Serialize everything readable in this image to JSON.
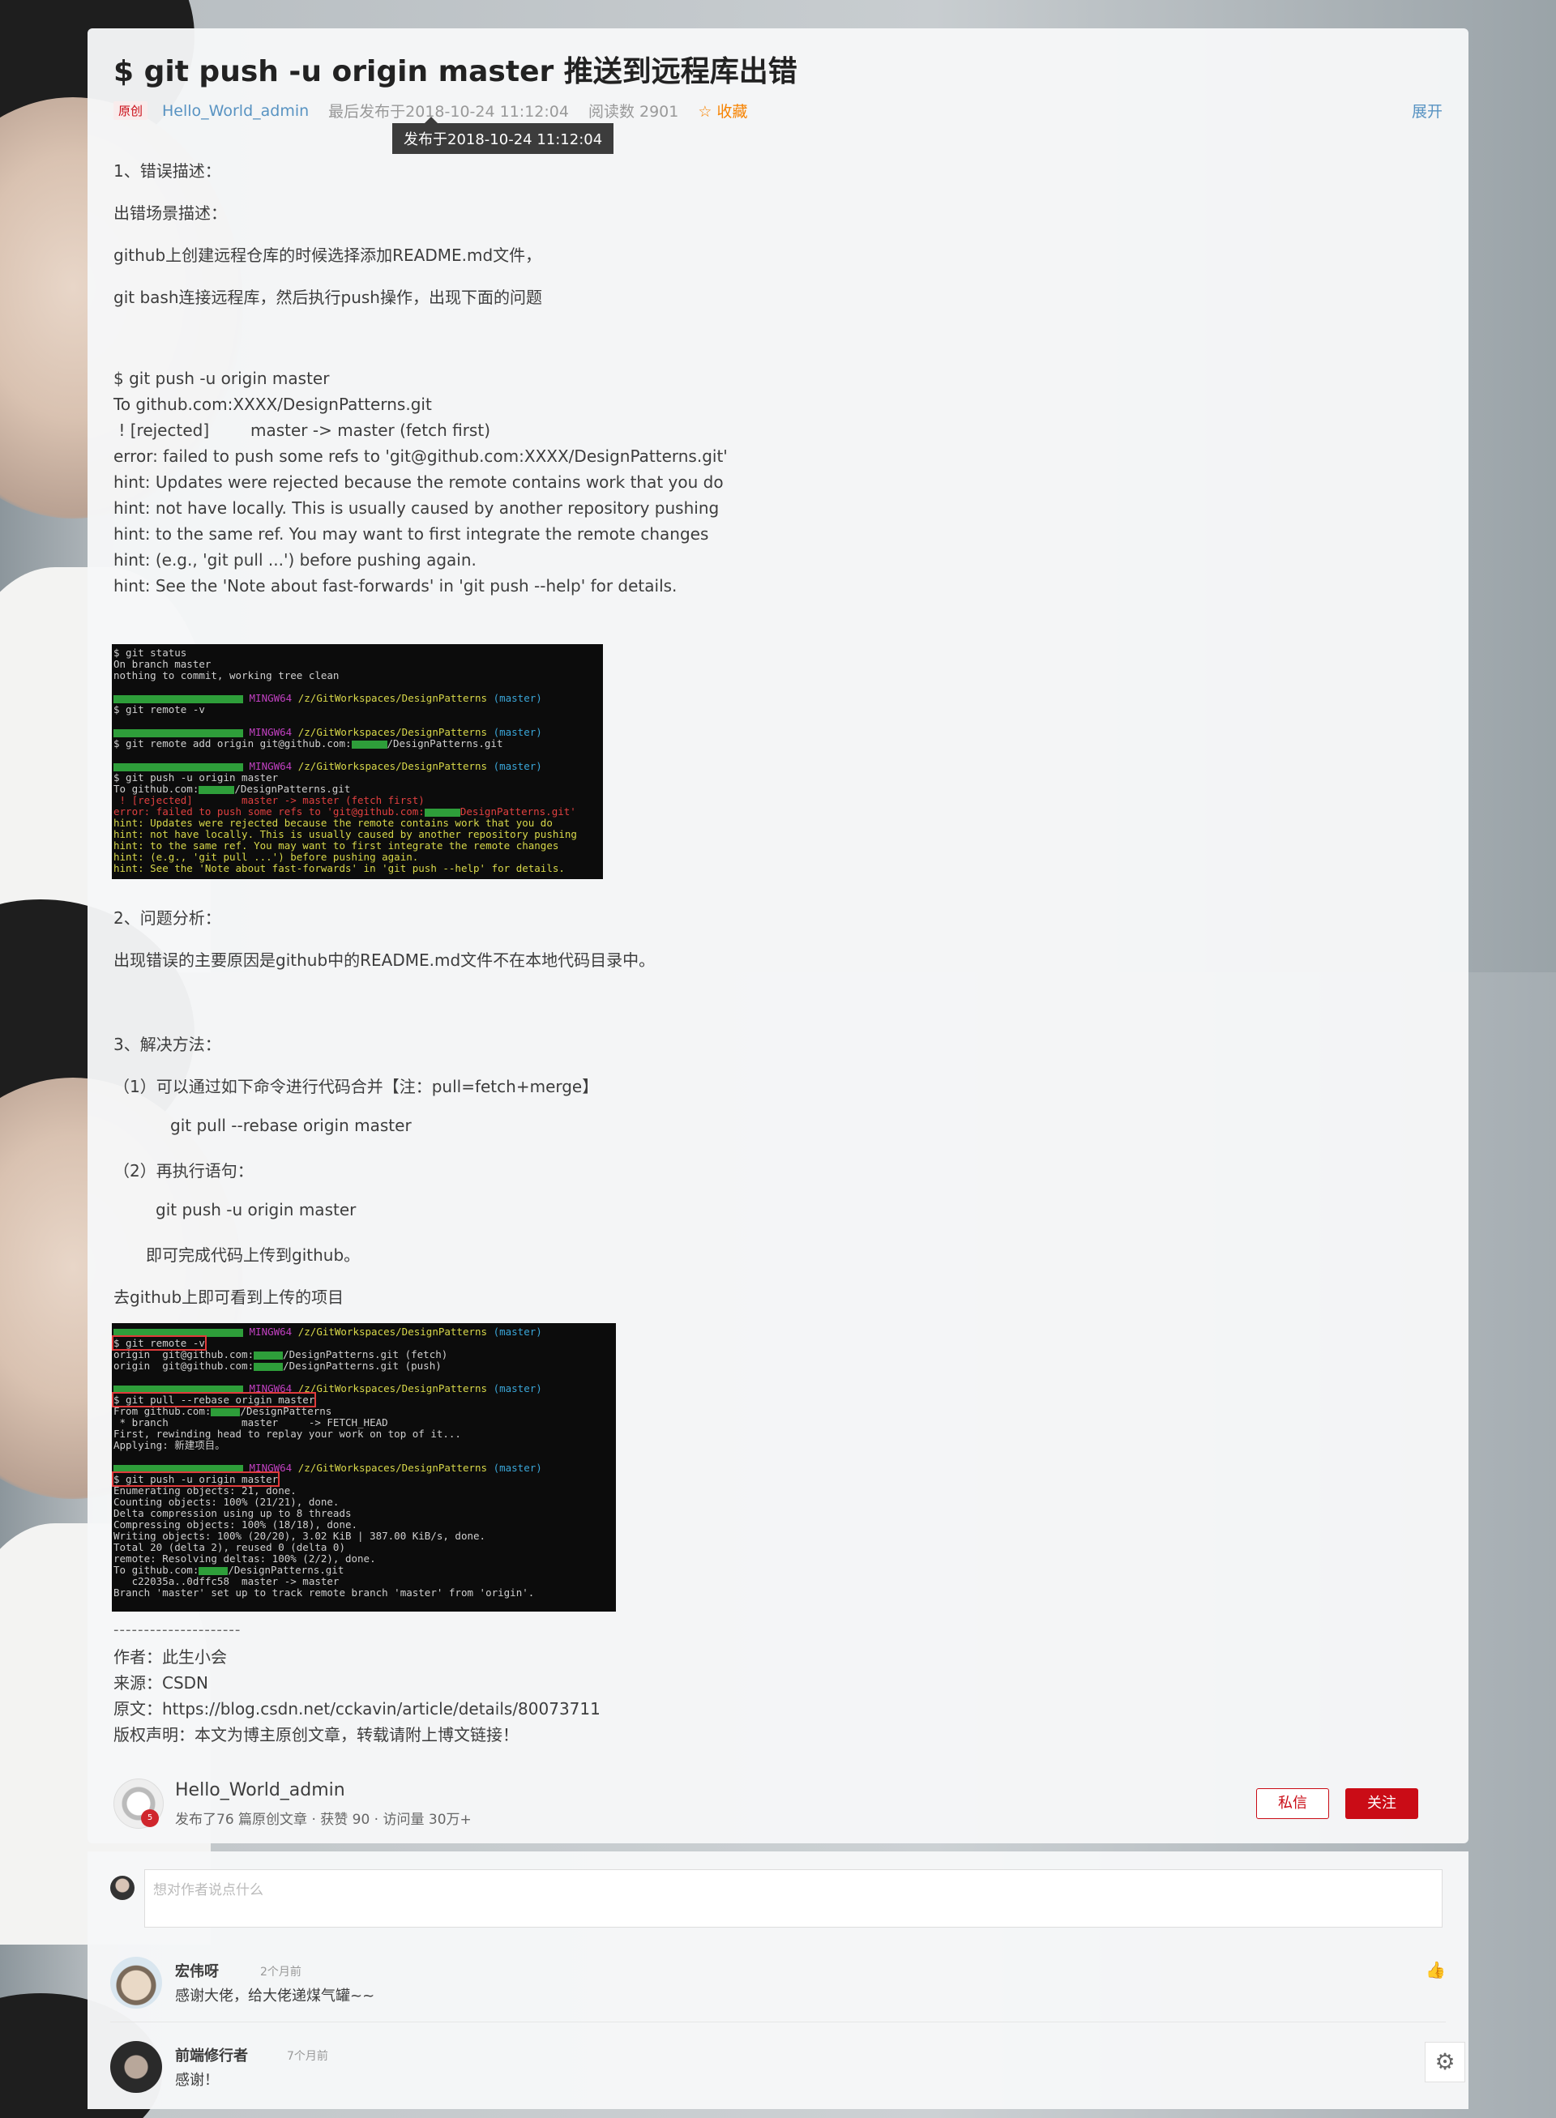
{
  "article": {
    "title": "$ git push -u origin master 推送到远程库出错",
    "badge": "原创",
    "author": "Hello_World_admin",
    "last_published": "最后发布于2018-10-24 11:12:04",
    "read_count": "阅读数 2901",
    "favorite": "收藏",
    "expand": "展开",
    "tooltip": "发布于2018-10-24 11:12:04"
  },
  "body": {
    "s1": "1、错误描述：",
    "s1_scene": "出错场景描述：",
    "s1_line1": "github上创建远程仓库的时候选择添加README.md文件，",
    "s1_line2": "git bash连接远程库，然后执行push操作，出现下面的问题",
    "error_log": [
      "$ git push -u origin master",
      "To github.com:XXXX/DesignPatterns.git",
      " ! [rejected]        master -> master (fetch first)",
      "error: failed to push some refs to 'git@github.com:XXXX/DesignPatterns.git'",
      "hint: Updates were rejected because the remote contains work that you do",
      "hint: not have locally. This is usually caused by another repository pushing",
      "hint: to the same ref. You may want to first integrate the remote changes",
      "hint: (e.g., 'git pull ...') before pushing again.",
      "hint: See the 'Note about fast-forwards' in 'git push --help' for details."
    ],
    "s2": "2、问题分析：",
    "s2_text": "出现错误的主要原因是github中的README.md文件不在本地代码目录中。",
    "s3": "3、解决方法：",
    "s3_step1": "（1）可以通过如下命令进行代码合并【注：pull=fetch+merge】",
    "s3_cmd1": "git pull --rebase origin master",
    "s3_step2": "（2）再执行语句：",
    "s3_cmd2": "git push -u origin master",
    "s3_done": "即可完成代码上传到github。",
    "s3_see": "去github上即可看到上传的项目",
    "separator": "---------------------",
    "footer": [
      "作者：此生小会",
      "来源：CSDN",
      "原文：https://blog.csdn.net/cckavin/article/details/80073711",
      "版权声明：本文为博主原创文章，转载请附上博文链接！"
    ]
  },
  "terminal1": {
    "l1": "$ git status",
    "l2": "On branch master",
    "l3": "nothing to commit, working tree clean",
    "mingw": "MINGW64",
    "path": "/z/GitWorkspaces/DesignPatterns",
    "branch": "(master)",
    "l5": "$ git remote -v",
    "l7a": "$ git remote add origin git@github.com:",
    "l7b": "/DesignPatterns.git",
    "l9": "$ git push -u origin master",
    "l10a": "To github.com:",
    "l10b": "/DesignPatterns.git",
    "l11": " ! [rejected]        master -> master (fetch first)",
    "l12a": "error: failed to push some refs to 'git@github.com:",
    "l12b": "DesignPatterns.git'",
    "l13": "hint: Updates were rejected because the remote contains work that you do",
    "l14": "hint: not have locally. This is usually caused by another repository pushing",
    "l15": "hint: to the same ref. You may want to first integrate the remote changes",
    "l16": "hint: (e.g., 'git pull ...') before pushing again.",
    "l17": "hint: See the 'Note about fast-forwards' in 'git push --help' for details."
  },
  "terminal2": {
    "mingw": "MINGW64",
    "path": "/z/GitWorkspaces/DesignPatterns",
    "branch": "(master)",
    "c1": "$ git remote -v",
    "o1a": "origin  git@github.com:",
    "o1b": "/DesignPatterns.git (fetch)",
    "o2a": "origin  git@github.com:",
    "o2b": "/DesignPatterns.git (push)",
    "c2": "$ git pull --rebase origin master",
    "p1a": "From github.com:",
    "p1b": "/DesignPatterns",
    "p2": " * branch            master     -> FETCH_HEAD",
    "p3": "First, rewinding head to replay your work on top of it...",
    "p4": "Applying: 新建项目。",
    "c3": "$ git push -u origin master",
    "u1": "Enumerating objects: 21, done.",
    "u2": "Counting objects: 100% (21/21), done.",
    "u3": "Delta compression using up to 8 threads",
    "u4": "Compressing objects: 100% (18/18), done.",
    "u5": "Writing objects: 100% (20/20), 3.02 KiB | 387.00 KiB/s, done.",
    "u6": "Total 20 (delta 2), reused 0 (delta 0)",
    "u7": "remote: Resolving deltas: 100% (2/2), done.",
    "u8a": "To github.com:",
    "u8b": "/DesignPatterns.git",
    "u9": "   c22035a..0dffc58  master -> master",
    "u10": "Branch 'master' set up to track remote branch 'master' from 'origin'."
  },
  "author_box": {
    "name": "Hello_World_admin",
    "stats": "发布了76 篇原创文章 · 获赞 90 · 访问量 30万+",
    "message": "私信",
    "follow": "关注"
  },
  "comments": {
    "placeholder": "想对作者说点什么",
    "items": [
      {
        "name": "宏伟呀",
        "time": "2个月前",
        "text": "感谢大佬，给大佬递煤气罐~~"
      },
      {
        "name": "前端修行者",
        "time": "7个月前",
        "text": "感谢！"
      }
    ]
  },
  "colors": {
    "accent": "#ca0c16",
    "link": "#5893c2",
    "favorite": "#f78300"
  }
}
